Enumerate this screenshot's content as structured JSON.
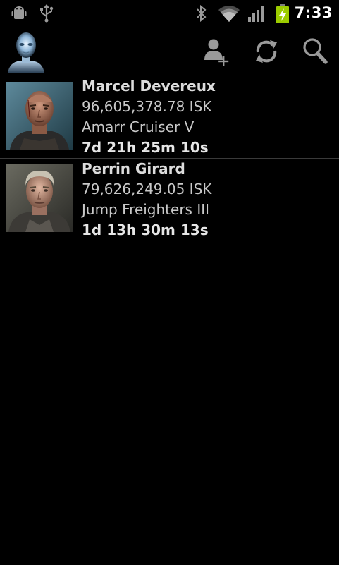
{
  "status_bar": {
    "time": "7:33",
    "icons": [
      "android-debug-icon",
      "usb-icon",
      "bluetooth-icon",
      "wifi-icon",
      "signal-icon",
      "battery-charging-icon"
    ]
  },
  "action_bar": {
    "logo_icon": "app-logo-icon",
    "actions": [
      {
        "icon": "add-character-icon"
      },
      {
        "icon": "refresh-icon"
      },
      {
        "icon": "search-icon"
      }
    ]
  },
  "characters": [
    {
      "name": "Marcel Devereux",
      "isk": "96,605,378.78 ISK",
      "skill": "Amarr Cruiser V",
      "time_remaining": "7d 21h 25m 10s"
    },
    {
      "name": "Perrin Girard",
      "isk": "79,626,249.05 ISK",
      "skill": "Jump Freighters III",
      "time_remaining": "1d 13h 30m 13s"
    }
  ]
}
